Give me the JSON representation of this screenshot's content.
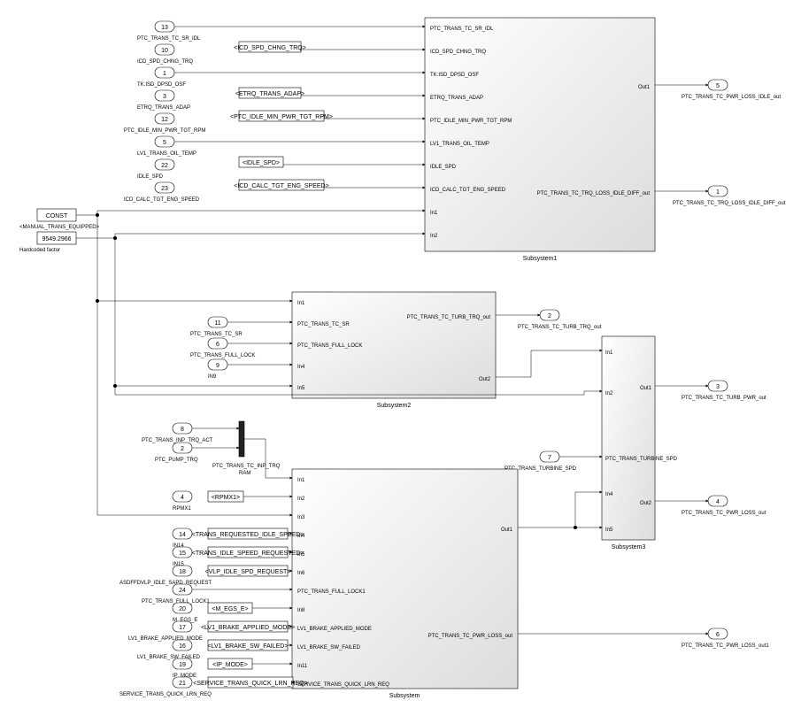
{
  "subsystem1": {
    "name": "Subsystem1",
    "inports": [
      "PTC_TRANS_TC_SR_IDL",
      "ICD_SPD_CHNG_TRQ",
      "TK:ISD_DPSD_OSF",
      "ETRQ_TRANS_ADAP",
      "PTC_IDLE_MIN_PWR_TGT_RPM",
      "LV1_TRANS_OIL_TEMP",
      "IDLE_SPD",
      "ICD_CALC_TGT_ENG_SPEED",
      "In1",
      "In2"
    ],
    "outports": [
      "Out1",
      "PTC_TRANS_TC_TRQ_LOSS_IDLE_DIFF_out"
    ],
    "sources": [
      {
        "id": "13",
        "label": "PTC_TRANS_TC_SR_IDL",
        "from": ""
      },
      {
        "id": "10",
        "label": "ICD_SPD_CHNG_TRQ",
        "from": "<ICD_SPD_CHNG_TRQ>"
      },
      {
        "id": "1",
        "label": "TK:ISD_DPSD_OSF",
        "from": ""
      },
      {
        "id": "3",
        "label": "ETRQ_TRANS_ADAP",
        "from": "<ETRQ_TRANS_ADAP>"
      },
      {
        "id": "12",
        "label": "PTC_IDLE_MIN_PWR_TGT_RPM",
        "from": "<PTC_IDLE_MIN_PWR_TGT_RPM>"
      },
      {
        "id": "5",
        "label": "LV1_TRANS_OIL_TEMP",
        "from": ""
      },
      {
        "id": "22",
        "label": "IDLE_SPD",
        "from": "<IDLE_SPD>"
      },
      {
        "id": "23",
        "label": "ICD_CALC_TGT_ENG_SPEED",
        "from": "<ICD_CALC_TGT_ENG_SPEED>"
      }
    ],
    "outs": [
      {
        "id": "5",
        "label": "PTC_TRANS_TC_PWR_LOSS_IDLE_out"
      },
      {
        "id": "1",
        "label": "PTC_TRANS_TC_TRQ_LOSS_IDLE_DIFF_out"
      }
    ]
  },
  "subsystem2": {
    "name": "Subsystem2",
    "inports": [
      "In1",
      "PTC_TRANS_TC_SR",
      "PTC_TRANS_FULL_LOCK",
      "In4",
      "In5"
    ],
    "outports": [
      "PTC_TRANS_TC_TURB_TRQ_out",
      "Out2"
    ],
    "sources": [
      {
        "id": "11",
        "label": "PTC_TRANS_TC_SR",
        "from": ""
      },
      {
        "id": "6",
        "label": "PTC_TRANS_FULL_LOCK",
        "from": ""
      },
      {
        "id": "9",
        "label": "IN9",
        "from": ""
      }
    ],
    "outs": [
      {
        "id": "2",
        "label": "PTC_TRANS_TC_TURB_TRQ_out"
      }
    ]
  },
  "subsystem3": {
    "name": "Subsystem3",
    "inports": [
      "In1",
      "In2",
      "PTC_TRANS_TURBINE_SPD",
      "In4",
      "In5"
    ],
    "outports": [
      "Out1",
      "Out2"
    ],
    "sources": [
      {
        "id": "7",
        "label": "PTC_TRANS_TURBINE_SPD",
        "from": ""
      }
    ],
    "outs": [
      {
        "id": "3",
        "label": "PTC_TRANS_TC_TURB_PWR_out"
      },
      {
        "id": "4",
        "label": "PTC_TRANS_TC_PWR_LOSS_out"
      }
    ]
  },
  "subsystem4": {
    "name": "Subsystem",
    "inports": [
      "In1",
      "In2",
      "In3",
      "In4",
      "In5",
      "In6",
      "PTC_TRANS_FULL_LOCK1",
      "In8",
      "LV1_BRAKE_APPLIED_MODE",
      "LV1_BRAKE_SW_FAILED",
      "In11",
      "SERVICE_TRANS_QUICK_LRN_REQ"
    ],
    "outports": [
      "Out1",
      "PTC_TRANS_TC_PWR_LOSS_out"
    ],
    "sources": [
      {
        "id": "4",
        "label": "RPMX1",
        "from": "<RPMX1>"
      },
      {
        "id": "14",
        "label": "IN14",
        "from": "<TRANS_REQUESTED_IDLE_SPEED>"
      },
      {
        "id": "15",
        "label": "IN15",
        "from": "<TRANS_IDLE_SPEED_REQUESTED>"
      },
      {
        "id": "18",
        "label": "ASDFFDVLP_IDLE_SAPD_REQUEST",
        "from": "<VLP_IDLE_SPD_REQUEST>"
      },
      {
        "id": "24",
        "label": "PTC_TRANS_FULL_LOCK1",
        "from": ""
      },
      {
        "id": "20",
        "label": "M_EGS_E",
        "from": "<M_EGS_E>"
      },
      {
        "id": "17",
        "label": "LV1_BRAKE_APPLIED_MODE",
        "from": "<LV1_BRAKE_APPLIED_MODE>"
      },
      {
        "id": "16",
        "label": "LV1_BRAKE_SW_FAILED",
        "from": "<LV1_BRAKE_SW_FAILED>"
      },
      {
        "id": "19",
        "label": "IP_MODE",
        "from": "<IP_MODE>"
      },
      {
        "id": "21",
        "label": "SERVICE_TRANS_QUICK_LRN_REQ",
        "from": "<SERVICE_TRANS_QUICK_LRN_REQ>"
      }
    ],
    "muxsources": [
      {
        "id": "8",
        "label": "PTC_TRANS_INP_TRQ_ACT"
      },
      {
        "id": "2",
        "label": "PTC_PUMP_TRQ"
      }
    ],
    "muxlabel": "PTC_TRANS_TC_INP_TRQ",
    "muxsub": "RAM",
    "outs": [
      {
        "id": "6",
        "label": "PTC_TRANS_TC_PWR_LOSS_out1"
      }
    ]
  },
  "constants": [
    {
      "text": "CONST",
      "sub": "<MANUAL_TRANS_EQUIPPED>"
    },
    {
      "text": "9549.2966",
      "sub": "Hardcoded factor"
    }
  ]
}
